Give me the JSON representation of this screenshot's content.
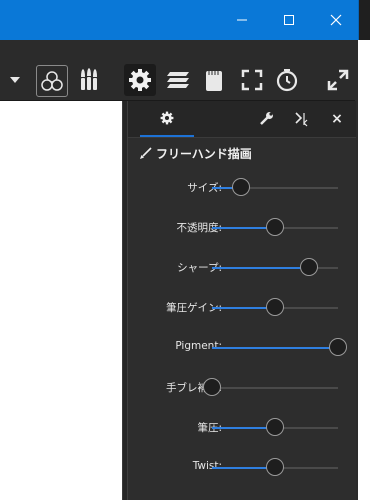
{
  "window": {
    "controls": [
      "minimize-icon",
      "maximize-icon",
      "close-icon"
    ],
    "accent": "#0a78d7"
  },
  "toolbar": {
    "icons": [
      "dropdown-arrow-icon",
      "color-circles-icon",
      "brushes-icon",
      "gear-icon",
      "layers-icon",
      "notepad-icon",
      "fullscreen-icon",
      "clock-icon",
      "expand-icon"
    ],
    "active_icon": "gear-icon"
  },
  "panel": {
    "active_tab_icon": "gear-icon",
    "header_icons": [
      "wrench-icon",
      "panel-switch-icon",
      "close-icon"
    ],
    "close_label": "×",
    "section_icon": "brush-icon",
    "section_title": "フリーハンド描画",
    "sliders": [
      {
        "label": "サイズ:",
        "value": 0.23
      },
      {
        "label": "不透明度:",
        "value": 0.5
      },
      {
        "label": "シャープ:",
        "value": 0.77
      },
      {
        "label": "筆圧ゲイン:",
        "value": 0.5
      },
      {
        "label": "Pigment:",
        "value": 1.0
      },
      {
        "label": "手ブレ補正:",
        "value": 0.0
      },
      {
        "label": "筆圧:",
        "value": 0.5
      },
      {
        "label": "Twist:",
        "value": 0.5
      }
    ]
  }
}
